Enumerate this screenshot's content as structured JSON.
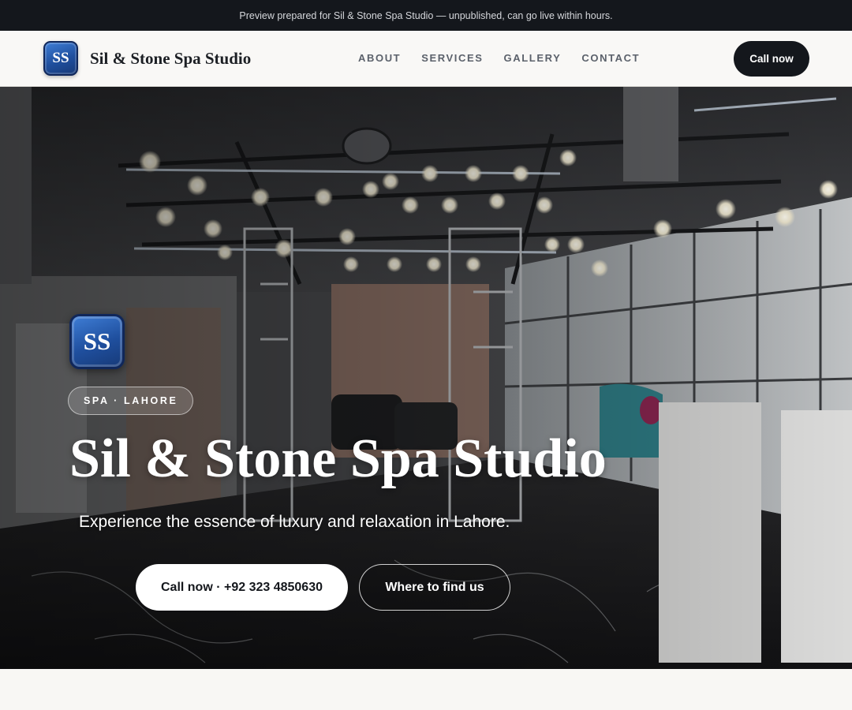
{
  "banner": {
    "text": "Preview prepared for Sil & Stone Spa Studio — unpublished, can go live within hours."
  },
  "nav": {
    "logo_text": "SS",
    "brand": "Sil & Stone Spa Studio",
    "links": [
      {
        "label": "ABOUT"
      },
      {
        "label": "SERVICES"
      },
      {
        "label": "GALLERY"
      },
      {
        "label": "CONTACT"
      }
    ],
    "cta_label": "Call now"
  },
  "hero": {
    "logo_text": "SS",
    "badge": "SPA · LAHORE",
    "title": "Sil & Stone Spa Studio",
    "subtitle": "Experience the essence of luxury and relaxation in Lahore.",
    "primary_button": "Call now · +92 323 4850630",
    "secondary_button": "Where to find us"
  },
  "colors": {
    "dark": "#14171c",
    "logo_blue": "#1f4f9e",
    "accent_teal": "#2f7d86"
  }
}
